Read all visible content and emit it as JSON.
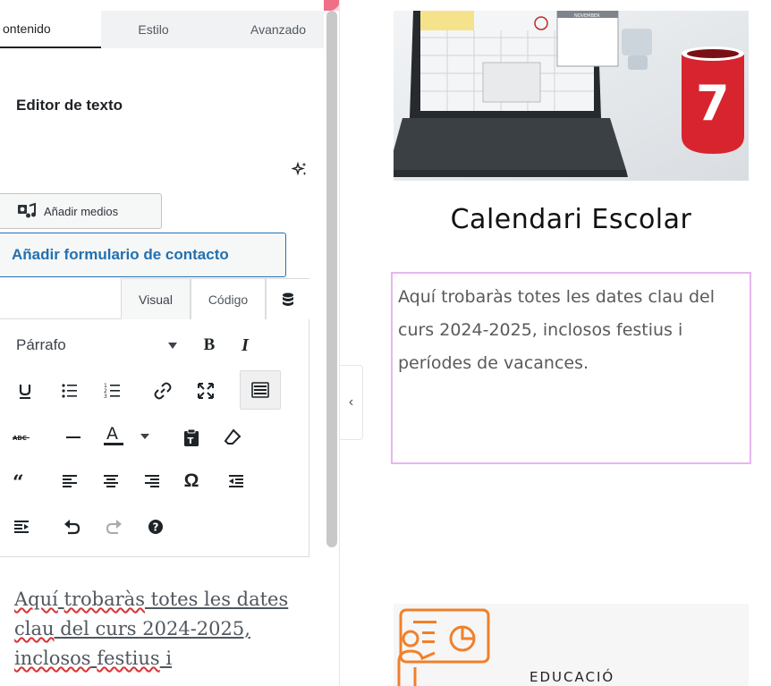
{
  "panel": {
    "tabs": [
      {
        "label": "ontenido"
      },
      {
        "label": "Estilo"
      },
      {
        "label": "Avanzado"
      }
    ],
    "section_title": "Editor de texto",
    "ai_icon": "sparkles-icon",
    "add_media_label": "Añadir medios",
    "add_form_label": "Añadir formulario de contacto",
    "editor_tabs": {
      "visual": "Visual",
      "code": "Código",
      "db_icon": "database-icon"
    },
    "format_select": "Párrafo",
    "toolbar_icons": [
      "bold-icon",
      "italic-icon",
      "underline-icon",
      "bullet-list-icon",
      "numbered-list-icon",
      "link-icon",
      "fullscreen-icon",
      "toolbar-toggle-icon",
      "strikethrough-icon",
      "horizontal-line-icon",
      "text-color-icon",
      "paste-text-icon",
      "clear-format-icon",
      "blockquote-icon",
      "align-left-icon",
      "align-center-icon",
      "align-right-icon",
      "special-char-icon",
      "outdent-icon",
      "indent-icon",
      "undo-icon",
      "redo-icon",
      "help-icon"
    ],
    "content_words": [
      "Aquí",
      " ",
      "trobaràs",
      " totes les dates ",
      "clau",
      " del curs 2024-2025, ",
      "inclosos",
      " ",
      "festius",
      " i"
    ]
  },
  "preview": {
    "title": "Calendari Escolar",
    "description": "Aquí trobaràs totes les dates clau del curs 2024-2025, inclosos festius i períodes de vacances.",
    "section_label": "EDUCACIÓ",
    "photo_calendar_month": "NOVEMBER",
    "photo_mug_number": "7"
  },
  "colors": {
    "accent_blue": "#2271b1",
    "selection_border": "#e7b6f0",
    "edu_orange": "#f0802a",
    "mug_red": "#d8242e"
  }
}
